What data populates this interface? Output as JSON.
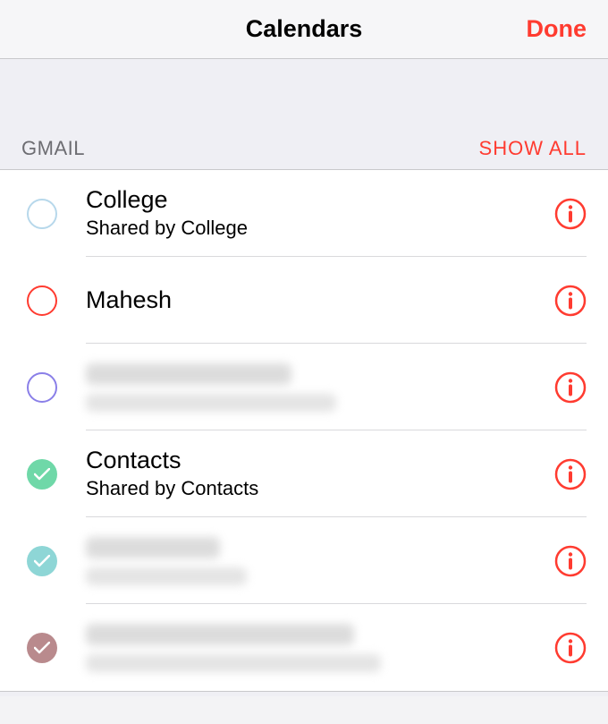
{
  "header": {
    "title": "Calendars",
    "done_label": "Done"
  },
  "section": {
    "label": "GMAIL",
    "show_all_label": "SHOW ALL"
  },
  "colors": {
    "red": "#ff3b30",
    "lightblue": "#b7d8eb",
    "purple": "#8a7fe8",
    "mint": "#6fd8a8",
    "teal": "#8ed6d6",
    "mauve": "#b98a8d"
  },
  "rows": [
    {
      "title": "College",
      "subtitle": "Shared by College",
      "checked": false,
      "color_key": "lightblue",
      "blurred": false,
      "title_blur_width": 0,
      "subtitle_blur_width": 0
    },
    {
      "title": "Mahesh",
      "subtitle": "",
      "checked": false,
      "color_key": "red",
      "blurred": false,
      "title_blur_width": 0,
      "subtitle_blur_width": 0
    },
    {
      "title": "",
      "subtitle": "",
      "checked": false,
      "color_key": "purple",
      "blurred": true,
      "title_blur_width": 230,
      "subtitle_blur_width": 280
    },
    {
      "title": "Contacts",
      "subtitle": "Shared by Contacts",
      "checked": true,
      "color_key": "mint",
      "blurred": false,
      "title_blur_width": 0,
      "subtitle_blur_width": 0
    },
    {
      "title": "",
      "subtitle": "",
      "checked": true,
      "color_key": "teal",
      "blurred": true,
      "title_blur_width": 150,
      "subtitle_blur_width": 180
    },
    {
      "title": "",
      "subtitle": "",
      "checked": true,
      "color_key": "mauve",
      "blurred": true,
      "title_blur_width": 300,
      "subtitle_blur_width": 330
    }
  ]
}
